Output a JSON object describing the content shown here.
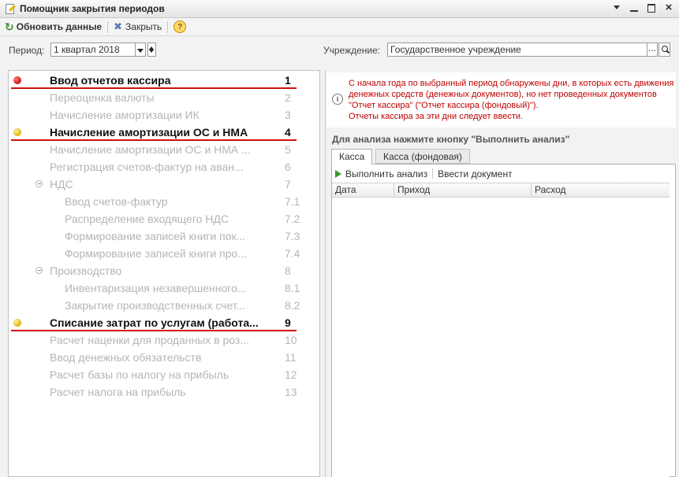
{
  "window": {
    "title": "Помощник закрытия периодов"
  },
  "toolbar": {
    "refresh_label": "Обновить данные",
    "close_label": "Закрыть",
    "help_label": "?"
  },
  "filters": {
    "period_label": "Период:",
    "period_value": "1 квартал 2018",
    "institution_label": "Учреждение:",
    "institution_value": "Государственное учреждение",
    "institution_select": "..."
  },
  "tasks": [
    {
      "label": "Ввод отчетов кассира",
      "num": "1",
      "status": "red",
      "bold": true,
      "level": 0
    },
    {
      "label": "Переоценка валюты",
      "num": "2",
      "status": "",
      "bold": false,
      "level": 0
    },
    {
      "label": "Начисление амортизации ИК",
      "num": "3",
      "status": "",
      "bold": false,
      "level": 0
    },
    {
      "label": "Начисление амортизации ОС и НМА",
      "num": "4",
      "status": "yellow",
      "bold": true,
      "level": 0
    },
    {
      "label": "Начисление амортизации ОС и НМА ...",
      "num": "5",
      "status": "",
      "bold": false,
      "level": 0
    },
    {
      "label": "Регистрация счетов-фактур на аван...",
      "num": "6",
      "status": "",
      "bold": false,
      "level": 0
    },
    {
      "label": "НДС",
      "num": "7",
      "status": "",
      "bold": false,
      "level": 1
    },
    {
      "label": "Ввод счетов-фактур",
      "num": "7.1",
      "status": "",
      "bold": false,
      "level": 2
    },
    {
      "label": "Распределение входящего НДС",
      "num": "7.2",
      "status": "",
      "bold": false,
      "level": 2
    },
    {
      "label": "Формирование записей книги пок...",
      "num": "7.3",
      "status": "",
      "bold": false,
      "level": 2
    },
    {
      "label": "Формирование записей книги про...",
      "num": "7.4",
      "status": "",
      "bold": false,
      "level": 2
    },
    {
      "label": "Производство",
      "num": "8",
      "status": "",
      "bold": false,
      "level": 1
    },
    {
      "label": "Инвентаризация незавершенного...",
      "num": "8.1",
      "status": "",
      "bold": false,
      "level": 2
    },
    {
      "label": "Закрытие производственных счет...",
      "num": "8.2",
      "status": "",
      "bold": false,
      "level": 2
    },
    {
      "label": "Списание затрат по услугам (работа...",
      "num": "9",
      "status": "yellow",
      "bold": true,
      "level": 0
    },
    {
      "label": "Расчет наценки для проданных в роз...",
      "num": "10",
      "status": "",
      "bold": false,
      "level": 0
    },
    {
      "label": "Ввод денежных обязательств",
      "num": "11",
      "status": "",
      "bold": false,
      "level": 0
    },
    {
      "label": "Расчет базы по налогу на прибыль",
      "num": "12",
      "status": "",
      "bold": false,
      "level": 0
    },
    {
      "label": "Расчет налога на прибыль",
      "num": "13",
      "status": "",
      "bold": false,
      "level": 0
    }
  ],
  "message": {
    "line1": "С начала года по выбранный период обнаружены дни, в которых есть движения",
    "line2": "денежных средств (денежных документов), но нет проведенных документов",
    "line3": "\"Отчет кассира\" (\"Отчет кассира (фондовый)\").",
    "line4": "Отчеты кассира за эти дни следует ввести."
  },
  "analysis": {
    "hint": "Для анализа нажмите кнопку \"Выполнить анализ\"",
    "tabs": [
      "Касса",
      "Касса (фондовая)"
    ],
    "run_label": "Выполнить анализ",
    "enter_doc_label": "Ввести документ",
    "columns": [
      "Дата",
      "Приход",
      "Расход"
    ]
  },
  "colors": {
    "status_red": "#d01010",
    "status_yellow": "#e0b000",
    "message_text": "#c00000",
    "underline": "#d01010"
  }
}
